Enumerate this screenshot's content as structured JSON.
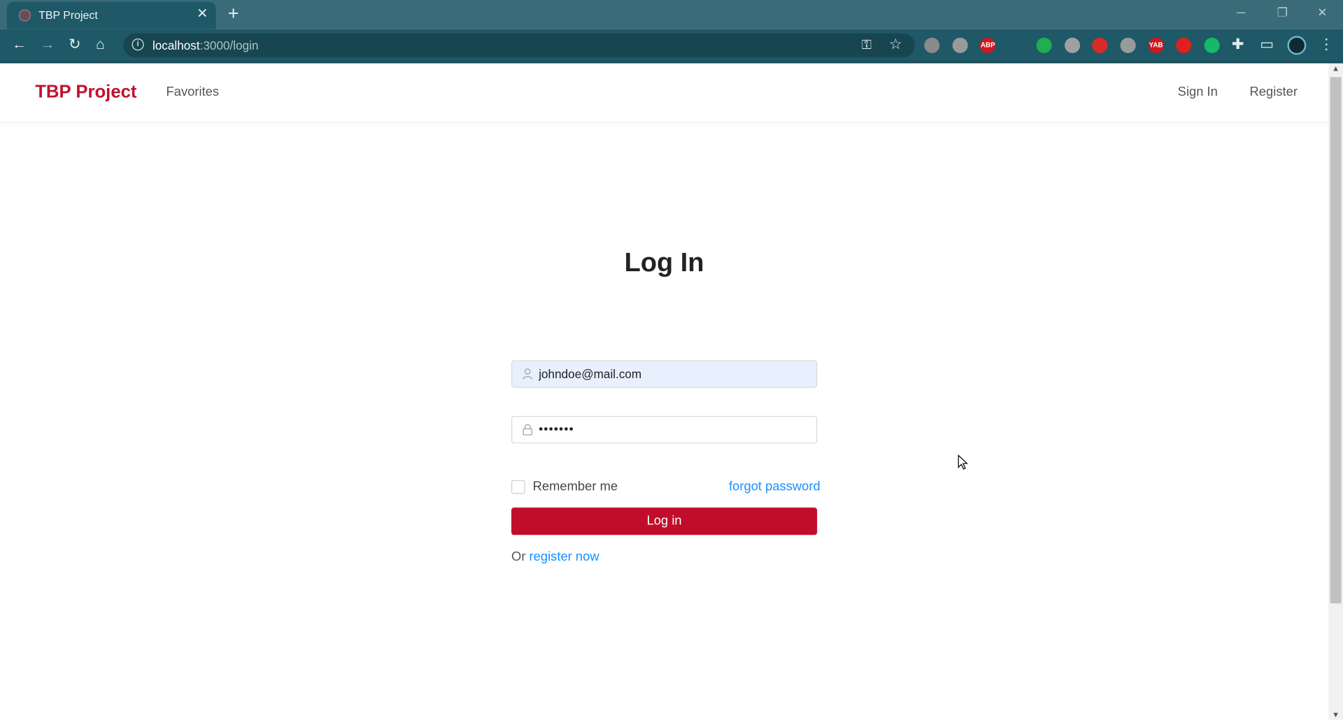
{
  "browser": {
    "tab_title": "TBP Project",
    "url_host": "localhost",
    "url_path": ":3000/login",
    "extensions": [
      {
        "name": "lightbulb-ext-icon",
        "color": "#8a8a8a",
        "label": ""
      },
      {
        "name": "owl-ext-icon",
        "color": "#9a9a9a",
        "label": ""
      },
      {
        "name": "adblock-ext-icon",
        "color": "#d0161f",
        "label": "ABP"
      },
      {
        "name": "pocket-ext-icon",
        "color": "#1f5866",
        "label": ""
      },
      {
        "name": "green-ext-icon",
        "color": "#1fae50",
        "label": ""
      },
      {
        "name": "box-ext-icon",
        "color": "#a0a0a0",
        "label": ""
      },
      {
        "name": "mendeley-ext-icon",
        "color": "#d72b2b",
        "label": ""
      },
      {
        "name": "translate-ext-icon",
        "color": "#9a9a9a",
        "label": ""
      },
      {
        "name": "yab-ext-icon",
        "color": "#d0161f",
        "label": "YAB"
      },
      {
        "name": "flag-ext-icon",
        "color": "#e02020",
        "label": ""
      },
      {
        "name": "circle-ext-icon",
        "color": "#16b86a",
        "label": ""
      }
    ]
  },
  "header": {
    "brand": "TBP Project",
    "nav_favorites": "Favorites",
    "nav_signin": "Sign In",
    "nav_register": "Register"
  },
  "login": {
    "title": "Log In",
    "email_value": "johndoe@mail.com",
    "password_value": "•••••••",
    "remember_label": "Remember me",
    "remember_checked": false,
    "forgot_label": "forgot password",
    "submit_label": "Log in",
    "or_text": "Or",
    "register_link": "register now"
  },
  "colors": {
    "brand": "#c0122f",
    "button": "#c10d2c",
    "link": "#1890ff",
    "autofill": "#e8f0fe"
  }
}
